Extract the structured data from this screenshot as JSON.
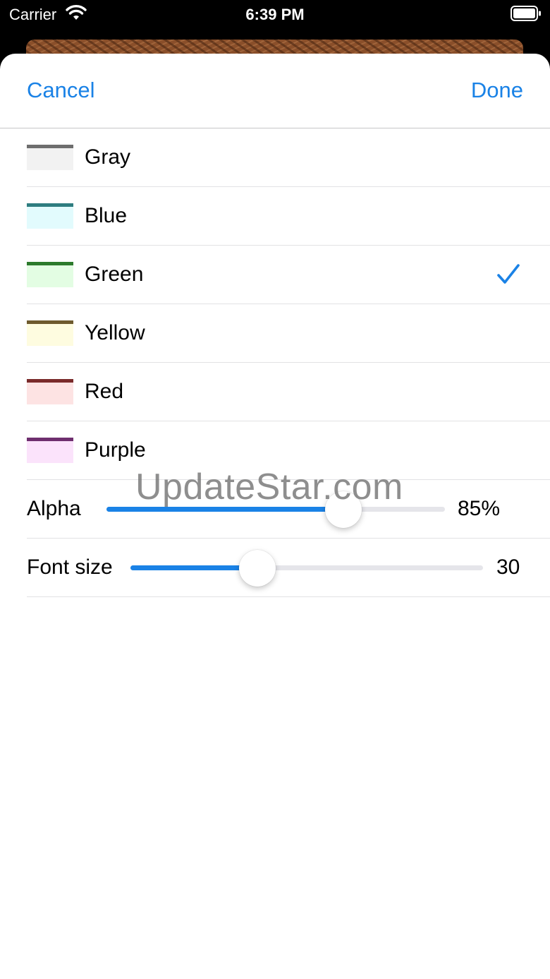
{
  "status_bar": {
    "carrier": "Carrier",
    "time": "6:39 PM"
  },
  "nav": {
    "cancel_label": "Cancel",
    "done_label": "Done"
  },
  "colors": [
    {
      "label": "Gray",
      "fill": "#f2f2f2",
      "bar": "#6e6e6e",
      "selected": false
    },
    {
      "label": "Blue",
      "fill": "#e2fbfd",
      "bar": "#2e7d80",
      "selected": false
    },
    {
      "label": "Green",
      "fill": "#e3fde3",
      "bar": "#2c7a2c",
      "selected": true
    },
    {
      "label": "Yellow",
      "fill": "#fefce0",
      "bar": "#6e5a2e",
      "selected": false
    },
    {
      "label": "Red",
      "fill": "#fde3e3",
      "bar": "#7a2a2a",
      "selected": false
    },
    {
      "label": "Purple",
      "fill": "#fbe3fb",
      "bar": "#6e2e6e",
      "selected": false
    }
  ],
  "alpha": {
    "label": "Alpha",
    "value_text": "85%",
    "fraction": 0.7
  },
  "font_size": {
    "label": "Font size",
    "value_text": "30",
    "fraction": 0.36
  },
  "accent_color": "#1a82e6",
  "watermark": "UpdateStar.com"
}
